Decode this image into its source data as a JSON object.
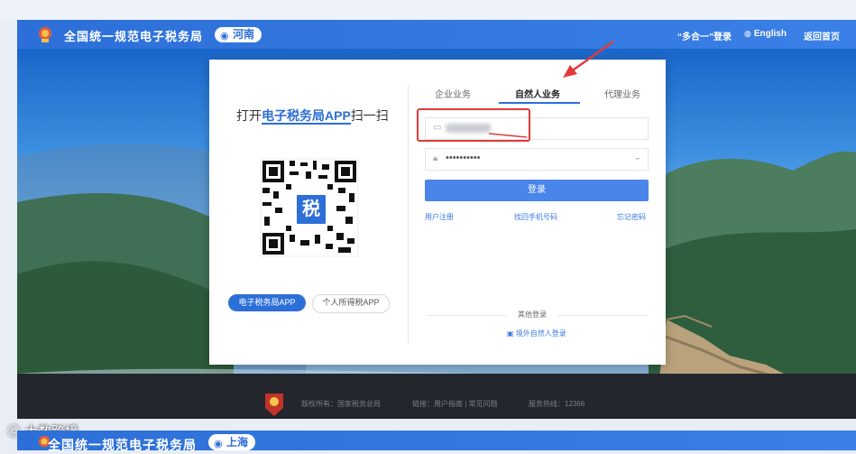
{
  "header": {
    "site_title": "全国统一规范电子税务局",
    "region": "河南",
    "links": {
      "unified_login": "“多合一”登录",
      "english": "English",
      "home": "返回首页"
    }
  },
  "scan_panel": {
    "title_prefix": "打开",
    "title_app": "电子税务局APP",
    "title_suffix": "扫一扫",
    "qr_center": "税",
    "buttons": {
      "tax_app": "电子税务局APP",
      "personal_tax_app": "个人所得税APP"
    }
  },
  "login_panel": {
    "tabs": [
      "企业业务",
      "自然人业务",
      "代理业务"
    ],
    "active_tab": "自然人业务",
    "password_mask": "••••••••••",
    "login_button": "登录",
    "links": {
      "register": "用户注册",
      "recover_phone": "找回手机号码",
      "forgot_password": "忘记密码"
    },
    "other_login_title": "其他登录",
    "foreign_login": "境外自然人登录"
  },
  "footer": {
    "copyright": "版权所有：国家税务总局",
    "links_text": "链接：用户指南 | 常见问题",
    "hotline": "服务热线：12366"
  },
  "watermark": "大数跨境",
  "lower_preview": {
    "site_title": "全国统一规范电子税务局",
    "region": "上海"
  },
  "colors": {
    "brand_blue": "#2d6fd8",
    "highlight_red": "#e23a3a",
    "footer_dark": "#23262c"
  },
  "icons": [
    "emblem-icon",
    "location-pin-icon",
    "globe-icon",
    "user-icon",
    "lock-icon",
    "eye-closed-icon",
    "qr-code-icon",
    "id-card-icon"
  ]
}
